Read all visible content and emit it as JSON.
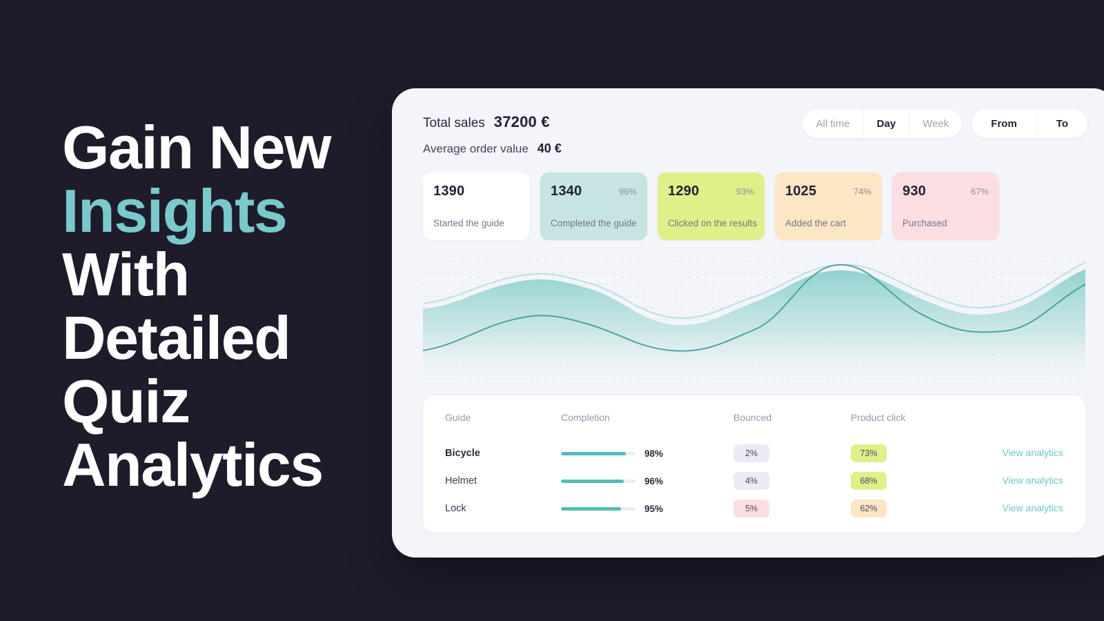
{
  "hero": {
    "lines": [
      {
        "text": "Gain New",
        "accent": false
      },
      {
        "text": "Insights",
        "accent": true
      },
      {
        "text": "With",
        "accent": false
      },
      {
        "text": "Detailed",
        "accent": false
      },
      {
        "text": "Quiz",
        "accent": false
      },
      {
        "text": "Analytics",
        "accent": false
      }
    ]
  },
  "colors": {
    "background": "#1e1c2b",
    "panel": "#f4f5fa",
    "accent_teal": "#7ac9cb",
    "line_teal": "#55bcb8",
    "card_white": "#ffffff",
    "card_teal": "#c5e4e2",
    "card_green": "#dff089",
    "card_orange": "#fde6c4",
    "card_pink": "#fcdde2",
    "badge_lavender": "#ecebf5"
  },
  "panel": {
    "summary": {
      "total_sales_label": "Total sales",
      "total_sales_value": "37200 €",
      "aov_label": "Average order value",
      "aov_value": "40 €"
    },
    "filters": {
      "period": [
        {
          "label": "All time",
          "active": false
        },
        {
          "label": "Day",
          "active": true
        },
        {
          "label": "Week",
          "active": false
        }
      ],
      "range": [
        {
          "label": "From"
        },
        {
          "label": "To"
        }
      ]
    },
    "funnel": [
      {
        "value": "1390",
        "percent": "",
        "caption": "Started the guide",
        "bg": "#ffffff"
      },
      {
        "value": "1340",
        "percent": "96%",
        "caption": "Completed the guide",
        "bg": "#c5e4e2"
      },
      {
        "value": "1290",
        "percent": "93%",
        "caption": "Clicked on the results",
        "bg": "#dff089"
      },
      {
        "value": "1025",
        "percent": "74%",
        "caption": "Added the cart",
        "bg": "#fde6c4"
      },
      {
        "value": "930",
        "percent": "67%",
        "caption": "Purchased",
        "bg": "#fcdde2"
      }
    ],
    "table": {
      "headers": [
        "Guide",
        "Completion",
        "Bounced",
        "Product click"
      ],
      "link_label": "View analytics",
      "rows": [
        {
          "guide": "Bicycle",
          "completion": "98%",
          "completion_value": 98,
          "bounced": "2%",
          "bounced_bg": "#ecebf5",
          "product_click": "73%",
          "product_bg": "#dff089"
        },
        {
          "guide": "Helmet",
          "completion": "96%",
          "completion_value": 96,
          "bounced": "4%",
          "bounced_bg": "#ecebf5",
          "product_click": "68%",
          "product_bg": "#dff089"
        },
        {
          "guide": "Lock",
          "completion": "95%",
          "completion_value": 95,
          "bounced": "5%",
          "bounced_bg": "#fcdde2",
          "product_click": "62%",
          "product_bg": "#fde6c4"
        }
      ]
    }
  },
  "chart_data": {
    "type": "area",
    "title": "",
    "xlabel": "",
    "ylabel": "",
    "grid": true,
    "gridlines": 11,
    "legend": "none",
    "xlim": [
      0,
      960
    ],
    "ylim": [
      0,
      100
    ],
    "series": [
      {
        "name": "Primary area",
        "style": "area-gradient",
        "color": "#8fd2cf",
        "x": [
          0,
          96,
          192,
          288,
          384,
          480,
          576,
          672,
          768,
          864,
          960
        ],
        "values": [
          58,
          62,
          80,
          72,
          52,
          58,
          82,
          74,
          56,
          68,
          90
        ]
      },
      {
        "name": "Upper outline",
        "style": "line-light",
        "color": "#b9e2e0",
        "x": [
          0,
          96,
          192,
          288,
          384,
          480,
          576,
          672,
          768,
          864,
          960
        ],
        "values": [
          62,
          68,
          86,
          78,
          58,
          66,
          90,
          80,
          60,
          74,
          96
        ]
      },
      {
        "name": "Secondary line",
        "style": "line-dark",
        "color": "#3f9c99",
        "x": [
          0,
          96,
          192,
          288,
          384,
          480,
          576,
          672,
          768,
          864,
          960
        ],
        "values": [
          30,
          38,
          62,
          54,
          40,
          48,
          86,
          62,
          48,
          58,
          82
        ]
      }
    ]
  }
}
